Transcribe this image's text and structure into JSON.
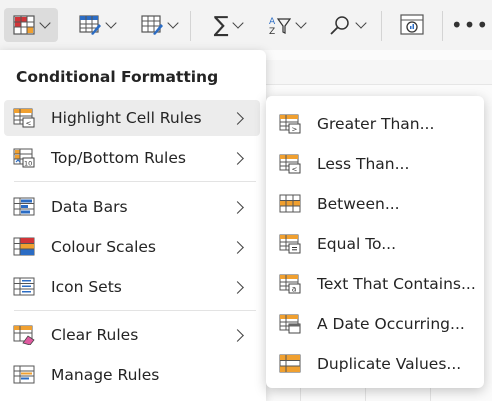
{
  "toolbar": {
    "buttons": [
      {
        "icon": "conditional-formatting-icon",
        "active": true
      },
      {
        "icon": "format-as-table-icon"
      },
      {
        "icon": "cell-styles-icon"
      },
      {
        "icon": "sum-icon"
      },
      {
        "icon": "sort-filter-icon"
      },
      {
        "icon": "find-search-icon"
      },
      {
        "icon": "analyze-data-icon"
      },
      {
        "icon": "more-options-icon"
      }
    ],
    "more_label": "•••"
  },
  "menu": {
    "title": "Conditional Formatting",
    "items": [
      {
        "label": "Highlight Cell Rules",
        "icon": "highlight-cell-rules-icon",
        "has_submenu": true
      },
      {
        "label": "Top/Bottom Rules",
        "icon": "top-bottom-rules-icon",
        "has_submenu": true
      },
      {
        "label": "Data Bars",
        "icon": "data-bars-icon",
        "has_submenu": true
      },
      {
        "label": "Colour Scales",
        "icon": "colour-scales-icon",
        "has_submenu": true
      },
      {
        "label": "Icon Sets",
        "icon": "icon-sets-icon",
        "has_submenu": true
      },
      {
        "label": "Clear Rules",
        "icon": "clear-rules-icon",
        "has_submenu": true
      },
      {
        "label": "Manage Rules",
        "icon": "manage-rules-icon",
        "has_submenu": false
      }
    ]
  },
  "submenu": {
    "items": [
      {
        "label": "Greater Than...",
        "icon": "greater-than-icon"
      },
      {
        "label": "Less Than...",
        "icon": "less-than-icon"
      },
      {
        "label": "Between...",
        "icon": "between-icon"
      },
      {
        "label": "Equal To...",
        "icon": "equal-to-icon"
      },
      {
        "label": "Text That Contains...",
        "icon": "text-contains-icon"
      },
      {
        "label": "A Date Occurring...",
        "icon": "date-occurring-icon"
      },
      {
        "label": "Duplicate Values...",
        "icon": "duplicate-values-icon"
      }
    ]
  },
  "colors": {
    "accent_orange": "#f0a030",
    "accent_blue": "#2b6cc4",
    "accent_red": "#d13438",
    "hover_bg": "#ececec"
  }
}
